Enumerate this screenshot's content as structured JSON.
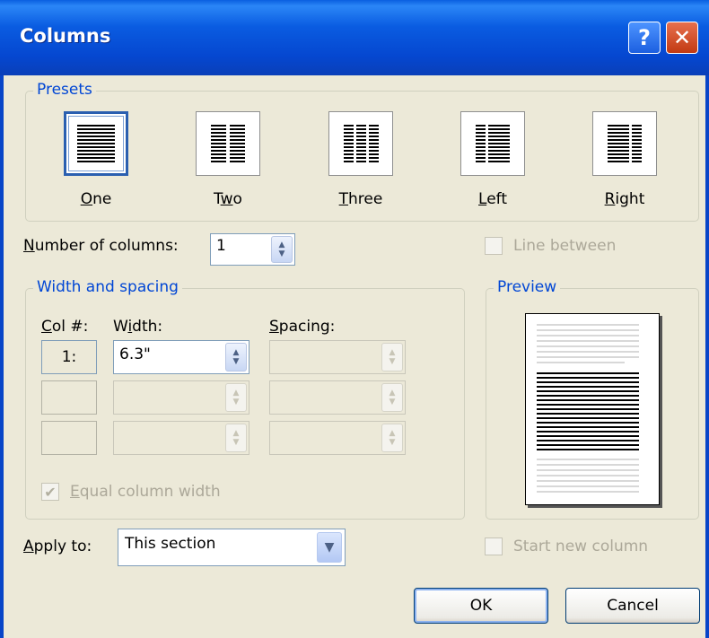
{
  "window": {
    "title": "Columns",
    "help_glyph": "?",
    "close_glyph": "✕"
  },
  "presets": {
    "legend": "Presets",
    "items": [
      {
        "label_accel": "O",
        "label_rest": "ne",
        "icon": "one-column-icon",
        "selected": true
      },
      {
        "label_pre": "T",
        "label_accel": "w",
        "label_rest": "o",
        "icon": "two-columns-icon",
        "selected": false
      },
      {
        "label_accel": "T",
        "label_rest": "hree",
        "icon": "three-columns-icon",
        "selected": false
      },
      {
        "label_accel": "L",
        "label_rest": "eft",
        "icon": "left-column-icon",
        "selected": false
      },
      {
        "label_accel": "R",
        "label_rest": "ight",
        "icon": "right-column-icon",
        "selected": false
      }
    ]
  },
  "number_of_columns": {
    "label_accel": "N",
    "label_rest": "umber of columns:",
    "value": "1"
  },
  "line_between": {
    "label": "Line between",
    "checked": false,
    "enabled": false
  },
  "width_spacing": {
    "legend": "Width and spacing",
    "col_header_accel": "C",
    "col_header_rest": "ol #:",
    "width_header_pre": "W",
    "width_header_accel": "i",
    "width_header_rest": "dth:",
    "spacing_header_accel": "S",
    "spacing_header_rest": "pacing:",
    "rows": [
      {
        "col": "1:",
        "width": "6.3\"",
        "spacing": ""
      },
      {
        "col": "",
        "width": "",
        "spacing": ""
      },
      {
        "col": "",
        "width": "",
        "spacing": ""
      }
    ],
    "equal_width": {
      "label_accel": "E",
      "label_rest": "qual column width",
      "checked": true,
      "enabled": false
    }
  },
  "preview": {
    "legend": "Preview"
  },
  "apply_to": {
    "label_accel": "A",
    "label_rest": "pply to:",
    "value": "This section"
  },
  "start_new_column": {
    "label": "Start new column",
    "checked": false,
    "enabled": false
  },
  "buttons": {
    "ok": "OK",
    "cancel": "Cancel"
  },
  "colors": {
    "titlebar": "#0a5ce1",
    "dialog_bg": "#ece9d8",
    "group_text": "#0046d5",
    "disabled_text": "#aca899"
  }
}
